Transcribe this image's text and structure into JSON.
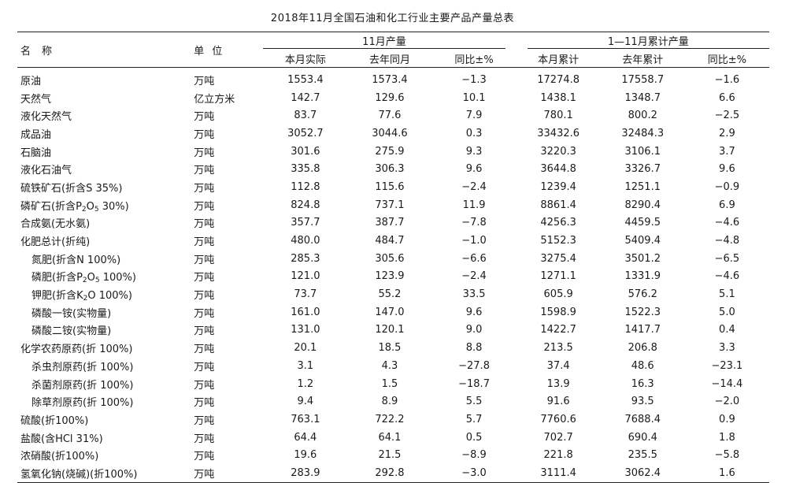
{
  "title": "2018年11月全国石油和化工行业主要产品产量总表",
  "header": {
    "name": "名称",
    "unit": "单位",
    "group_nov": "11月产量",
    "group_cum": "1—11月累计产量",
    "sub": [
      "本月实际",
      "去年同月",
      "同比±%",
      "本月累计",
      "去年累计",
      "同比±%"
    ]
  },
  "rows": [
    {
      "name": "原油",
      "unit": "万吨",
      "v": [
        "1553.4",
        "1573.4",
        "−1.3",
        "17274.8",
        "17558.7",
        "−1.6"
      ]
    },
    {
      "name": "天然气",
      "unit": "亿立方米",
      "v": [
        "142.7",
        "129.6",
        "10.1",
        "1438.1",
        "1348.7",
        "6.6"
      ]
    },
    {
      "name": "液化天然气",
      "unit": "万吨",
      "v": [
        "83.7",
        "77.6",
        "7.9",
        "780.1",
        "800.2",
        "−2.5"
      ]
    },
    {
      "name": "成品油",
      "unit": "万吨",
      "v": [
        "3052.7",
        "3044.6",
        "0.3",
        "33432.6",
        "32484.3",
        "2.9"
      ]
    },
    {
      "name": "石脑油",
      "unit": "万吨",
      "v": [
        "301.6",
        "275.9",
        "9.3",
        "3220.3",
        "3106.1",
        "3.7"
      ]
    },
    {
      "name": "液化石油气",
      "unit": "万吨",
      "v": [
        "335.8",
        "306.3",
        "9.6",
        "3644.8",
        "3326.7",
        "9.6"
      ]
    },
    {
      "name": "硫铁矿石(折含S 35%)",
      "unit": "万吨",
      "v": [
        "112.8",
        "115.6",
        "−2.4",
        "1239.4",
        "1251.1",
        "−0.9"
      ]
    },
    {
      "name": "磷矿石(折含P2O5 30%)",
      "unit": "万吨",
      "v": [
        "824.8",
        "737.1",
        "11.9",
        "8861.4",
        "8290.4",
        "6.9"
      ]
    },
    {
      "name": "合成氨(无水氨)",
      "unit": "万吨",
      "v": [
        "357.7",
        "387.7",
        "−7.8",
        "4256.3",
        "4459.5",
        "−4.6"
      ]
    },
    {
      "name": "化肥总计(折纯)",
      "unit": "万吨",
      "v": [
        "480.0",
        "484.7",
        "−1.0",
        "5152.3",
        "5409.4",
        "−4.8"
      ]
    },
    {
      "name": "氮肥(折含N 100%)",
      "unit": "万吨",
      "indent": true,
      "v": [
        "285.3",
        "305.6",
        "−6.6",
        "3275.4",
        "3501.2",
        "−6.5"
      ]
    },
    {
      "name": "磷肥(折含P2O5 100%)",
      "unit": "万吨",
      "indent": true,
      "v": [
        "121.0",
        "123.9",
        "−2.4",
        "1271.1",
        "1331.9",
        "−4.6"
      ]
    },
    {
      "name": "钾肥(折含K2O 100%)",
      "unit": "万吨",
      "indent": true,
      "v": [
        "73.7",
        "55.2",
        "33.5",
        "605.9",
        "576.2",
        "5.1"
      ]
    },
    {
      "name": "磷酸一铵(实物量)",
      "unit": "万吨",
      "indent": true,
      "v": [
        "161.0",
        "147.0",
        "9.6",
        "1598.9",
        "1522.3",
        "5.0"
      ]
    },
    {
      "name": "磷酸二铵(实物量)",
      "unit": "万吨",
      "indent": true,
      "v": [
        "131.0",
        "120.1",
        "9.0",
        "1422.7",
        "1417.7",
        "0.4"
      ]
    },
    {
      "name": "化学农药原药(折 100%)",
      "unit": "万吨",
      "v": [
        "20.1",
        "18.5",
        "8.8",
        "213.5",
        "206.8",
        "3.3"
      ]
    },
    {
      "name": "杀虫剂原药(折 100%)",
      "unit": "万吨",
      "indent": true,
      "v": [
        "3.1",
        "4.3",
        "−27.8",
        "37.4",
        "48.6",
        "−23.1"
      ]
    },
    {
      "name": "杀菌剂原药(折 100%)",
      "unit": "万吨",
      "indent": true,
      "v": [
        "1.2",
        "1.5",
        "−18.7",
        "13.9",
        "16.3",
        "−14.4"
      ]
    },
    {
      "name": "除草剂原药(折 100%)",
      "unit": "万吨",
      "indent": true,
      "v": [
        "9.4",
        "8.9",
        "5.5",
        "91.6",
        "93.5",
        "−2.0"
      ]
    },
    {
      "name": "硫酸(折100%)",
      "unit": "万吨",
      "v": [
        "763.1",
        "722.2",
        "5.7",
        "7760.6",
        "7688.4",
        "0.9"
      ]
    },
    {
      "name": "盐酸(含HCl 31%)",
      "unit": "万吨",
      "v": [
        "64.4",
        "64.1",
        "0.5",
        "702.7",
        "690.4",
        "1.8"
      ]
    },
    {
      "name": "浓硝酸(折100%)",
      "unit": "万吨",
      "v": [
        "19.6",
        "21.5",
        "−8.9",
        "221.8",
        "235.5",
        "−5.8"
      ]
    },
    {
      "name": "氢氧化钠(烧碱)(折100%)",
      "unit": "万吨",
      "v": [
        "283.9",
        "292.8",
        "−3.0",
        "3111.4",
        "3062.4",
        "1.6"
      ]
    }
  ]
}
